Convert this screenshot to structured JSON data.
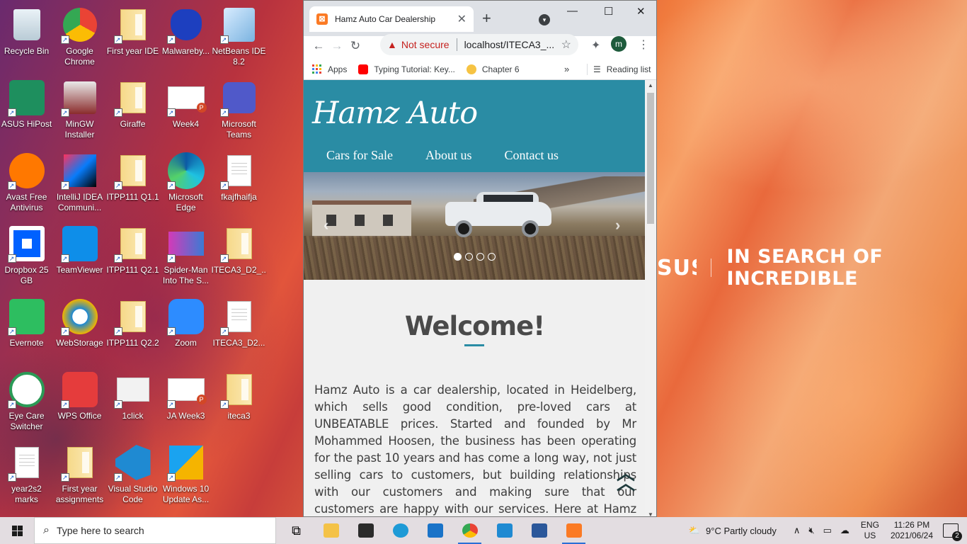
{
  "desktop": {
    "brand_logo": "SUS",
    "brand_tagline": "IN SEARCH OF INCREDIBLE",
    "icons": [
      {
        "label": "Recycle Bin",
        "icon": "recycle-bin-icon"
      },
      {
        "label": "Google Chrome",
        "icon": "chrome-icon"
      },
      {
        "label": "First year IDE",
        "icon": "folder-icon"
      },
      {
        "label": "Malwareby...",
        "icon": "malwarebytes-icon"
      },
      {
        "label": "NetBeans IDE 8.2",
        "icon": "netbeans-icon"
      },
      {
        "label": "ASUS HiPost",
        "icon": "asus-hipost-icon"
      },
      {
        "label": "MinGW Installer",
        "icon": "mingw-icon"
      },
      {
        "label": "Giraffe",
        "icon": "folder-icon"
      },
      {
        "label": "Week4",
        "icon": "powerpoint-file-icon"
      },
      {
        "label": "Microsoft Teams",
        "icon": "teams-icon"
      },
      {
        "label": "Avast Free Antivirus",
        "icon": "avast-icon"
      },
      {
        "label": "IntelliJ IDEA Communi...",
        "icon": "intellij-icon"
      },
      {
        "label": "ITPP111 Q1.1",
        "icon": "folder-icon"
      },
      {
        "label": "Microsoft Edge",
        "icon": "edge-icon"
      },
      {
        "label": "fkajfhaifja",
        "icon": "text-file-icon"
      },
      {
        "label": "Dropbox 25 GB",
        "icon": "dropbox-icon"
      },
      {
        "label": "TeamViewer",
        "icon": "teamviewer-icon"
      },
      {
        "label": "ITPP111 Q2.1",
        "icon": "folder-icon"
      },
      {
        "label": "Spider-Man Into The S...",
        "icon": "video-file-icon"
      },
      {
        "label": "ITECA3_D2_...",
        "icon": "folder-icon"
      },
      {
        "label": "Evernote",
        "icon": "evernote-icon"
      },
      {
        "label": "WebStorage",
        "icon": "webstorage-icon"
      },
      {
        "label": "ITPP111 Q2.2",
        "icon": "folder-icon"
      },
      {
        "label": "Zoom",
        "icon": "zoom-icon"
      },
      {
        "label": "ITECA3_D2...",
        "icon": "text-file-icon"
      },
      {
        "label": "Eye Care Switcher",
        "icon": "eye-care-icon"
      },
      {
        "label": "WPS Office",
        "icon": "wps-office-icon"
      },
      {
        "label": "1click",
        "icon": "gear-file-icon"
      },
      {
        "label": "JA Week3",
        "icon": "powerpoint-file-icon"
      },
      {
        "label": "iteca3",
        "icon": "folder-icon"
      },
      {
        "label": "year2s2 marks",
        "icon": "text-file-icon"
      },
      {
        "label": "First year assignments",
        "icon": "folder-icon"
      },
      {
        "label": "Visual Studio Code",
        "icon": "vscode-icon"
      },
      {
        "label": "Windows 10 Update As...",
        "icon": "windows-update-icon"
      }
    ]
  },
  "browser": {
    "tab_title": "Hamz Auto Car Dealership",
    "security_label": "Not secure",
    "url": "localhost/ITECA3_...",
    "profile_initial": "m",
    "bookmarks": [
      {
        "label": "Apps",
        "icon": "apps-grid-icon"
      },
      {
        "label": "Typing Tutorial: Key...",
        "icon": "youtube-icon"
      },
      {
        "label": "Chapter 6",
        "icon": "bookmark-favicon-icon"
      }
    ],
    "reading_list": "Reading list"
  },
  "site": {
    "brand": "Hamz Auto",
    "nav": [
      "Cars for Sale",
      "About us",
      "Contact us"
    ],
    "carousel": {
      "slides": 4,
      "active": 1
    },
    "welcome_heading": "Welcome!",
    "about_text": "Hamz Auto is a car dealership, located in Heidelberg, which sells good condition, pre-loved cars at UNBEATABLE prices. Started and founded by Mr Mohammed Hoosen, the business has been operating for the past 10 years and has come a long way, not just selling cars to customers, but building relationships with our customers and making sure that our customers are happy with our services. Here at Hamz Auto, the customer is treated like"
  },
  "taskbar": {
    "search_placeholder": "Type here to search",
    "apps": [
      "task-view-icon",
      "file-explorer-icon",
      "store-icon",
      "edge-icon",
      "mail-icon",
      "chrome-icon",
      "vscode-icon",
      "word-icon",
      "xampp-icon"
    ],
    "weather": "9°C  Partly cloudy",
    "lang_1": "ENG",
    "lang_2": "US",
    "time": "11:26 PM",
    "date": "2021/06/24",
    "notifications": "2"
  }
}
